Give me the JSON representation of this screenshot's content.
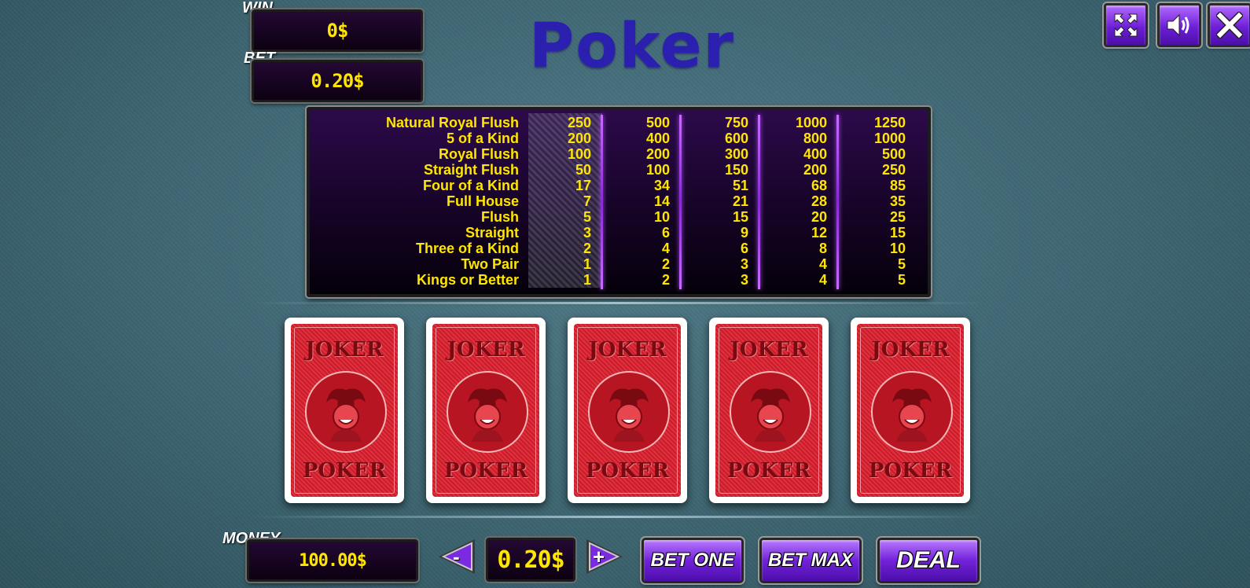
{
  "title": "Poker",
  "win": {
    "label": "WIN",
    "value": "0$"
  },
  "bet": {
    "label": "BET",
    "value": "0.20$"
  },
  "money": {
    "label": "MONEY",
    "value": "100.00$"
  },
  "top_buttons": {
    "fullscreen_icon": "fullscreen-icon",
    "sound_icon": "speaker-icon",
    "close_icon": "close-icon"
  },
  "paytable": {
    "hands": [
      "Natural Royal Flush",
      "5 of a Kind",
      "Royal Flush",
      "Straight Flush",
      "Four of a Kind",
      "Full House",
      "Flush",
      "Straight",
      "Three of a Kind",
      "Two Pair",
      "Kings or Better"
    ],
    "columns": [
      [
        "250",
        "200",
        "100",
        "50",
        "17",
        "7",
        "5",
        "3",
        "2",
        "1",
        "1"
      ],
      [
        "500",
        "400",
        "200",
        "100",
        "34",
        "14",
        "10",
        "6",
        "4",
        "2",
        "2"
      ],
      [
        "750",
        "600",
        "300",
        "150",
        "51",
        "21",
        "15",
        "9",
        "6",
        "3",
        "3"
      ],
      [
        "1000",
        "800",
        "400",
        "200",
        "68",
        "28",
        "20",
        "12",
        "8",
        "4",
        "4"
      ],
      [
        "1250",
        "1000",
        "500",
        "250",
        "85",
        "35",
        "25",
        "15",
        "10",
        "5",
        "5"
      ]
    ],
    "active_column": 1
  },
  "cards": [
    {
      "top": "JOKER",
      "bottom": "POKER"
    },
    {
      "top": "JOKER",
      "bottom": "POKER"
    },
    {
      "top": "JOKER",
      "bottom": "POKER"
    },
    {
      "top": "JOKER",
      "bottom": "POKER"
    },
    {
      "top": "JOKER",
      "bottom": "POKER"
    }
  ],
  "controls": {
    "decrease_label": "-",
    "increase_label": "+",
    "bet_value": "0.20$",
    "bet_one_label": "BET ONE",
    "bet_max_label": "BET MAX",
    "deal_label": "DEAL"
  },
  "colors": {
    "accent_purple": "#7222da",
    "value_yellow": "#ffe600",
    "card_red": "#d62a36",
    "title_blue": "#2a1fae"
  }
}
